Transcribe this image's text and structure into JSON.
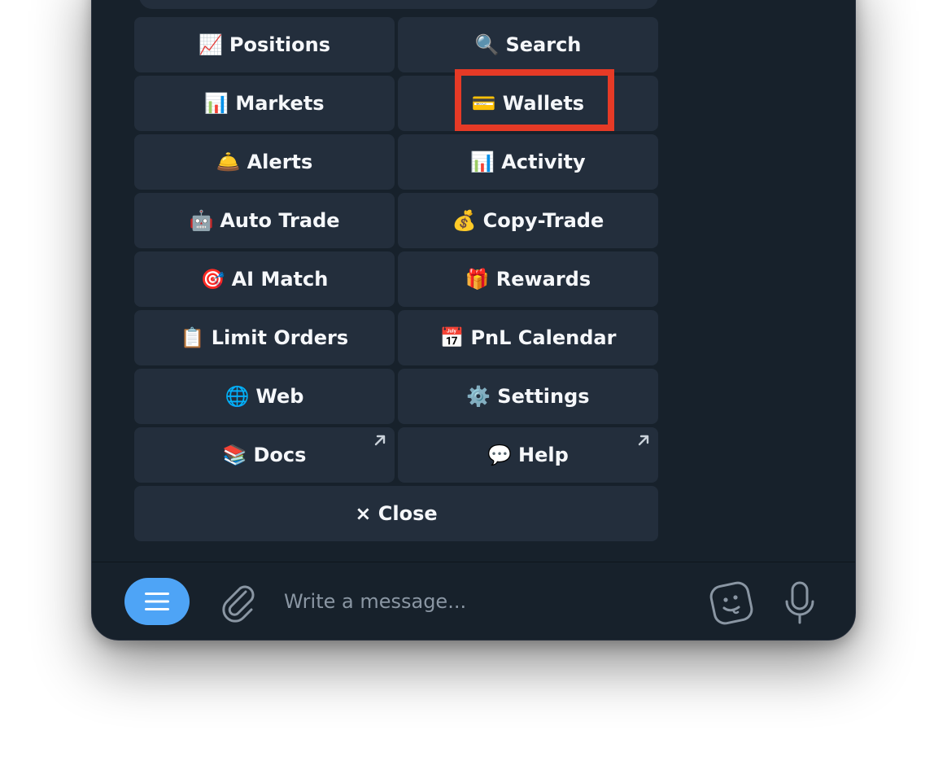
{
  "keyboard": {
    "buttons": [
      {
        "emoji": "📈",
        "label": "Positions"
      },
      {
        "emoji": "🔍",
        "label": "Search"
      },
      {
        "emoji": "📊",
        "label": "Markets"
      },
      {
        "emoji": "💳",
        "label": "Wallets"
      },
      {
        "emoji": "🛎️",
        "label": "Alerts"
      },
      {
        "emoji": "📊",
        "label": "Activity"
      },
      {
        "emoji": "🤖",
        "label": "Auto Trade"
      },
      {
        "emoji": "💰",
        "label": "Copy-Trade"
      },
      {
        "emoji": "🎯",
        "label": "AI Match"
      },
      {
        "emoji": "🎁",
        "label": "Rewards"
      },
      {
        "emoji": "📋",
        "label": "Limit Orders"
      },
      {
        "emoji": "📅",
        "label": "PnL Calendar"
      },
      {
        "emoji": "🌐",
        "label": "Web"
      },
      {
        "emoji": "⚙️",
        "label": "Settings"
      },
      {
        "emoji": "📚",
        "label": "Docs"
      },
      {
        "emoji": "💬",
        "label": "Help"
      }
    ],
    "close_label": "× Close"
  },
  "composer": {
    "placeholder": "Write a message..."
  },
  "colors": {
    "background": "#17212b",
    "button": "#232e3c",
    "accent": "#4ea4f6",
    "highlight": "#e63a26"
  },
  "icons": {
    "menu": "menu-icon",
    "attach": "paperclip-icon",
    "sticker": "sticker-icon",
    "mic": "microphone-icon",
    "external": "external-link-arrow-icon"
  }
}
